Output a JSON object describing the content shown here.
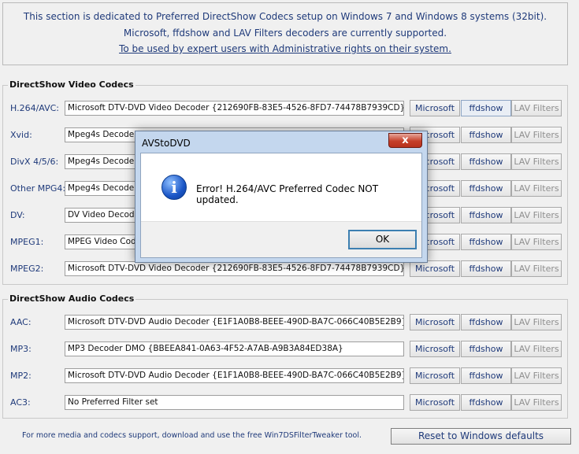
{
  "header": {
    "line1": "This section is dedicated to Preferred DirectShow Codecs setup on Windows 7 and Windows 8 systems (32bit).",
    "line2": "Microsoft, ffdshow and LAV Filters decoders are currently supported.",
    "link": "To be used by expert users with Administrative rights on their system."
  },
  "video": {
    "title": "DirectShow Video Codecs",
    "rows": [
      {
        "label": "H.264/AVC:",
        "value": "Microsoft DTV-DVD Video Decoder {212690FB-83E5-4526-8FD7-74478B7939CD}"
      },
      {
        "label": "Xvid:",
        "value": "Mpeg4s Decoder DMO {2A11BAE2-FE6E-4249-864B-9E9ED6E8DBC2}"
      },
      {
        "label": "DivX 4/5/6:",
        "value": "Mpeg4s Decoder DMO {2A11BAE2-FE6E-4249-864B-9E9ED6E8DBC2}"
      },
      {
        "label": "Other MPG4:",
        "value": "Mpeg4s Decoder DMO {2A11BAE2-FE6E-4249-864B-9E9ED6E8DBC2}"
      },
      {
        "label": "DV:",
        "value": "DV Video Decoder {B1B77C00-C3E4-11CF-AF79-00AA00B67A42}"
      },
      {
        "label": "MPEG1:",
        "value": "MPEG Video Codec {FEB50740-7BEF-11CE-9BD9-0000E202599C}"
      },
      {
        "label": "MPEG2:",
        "value": "Microsoft DTV-DVD Video Decoder {212690FB-83E5-4526-8FD7-74478B7939CD}"
      }
    ]
  },
  "audio": {
    "title": "DirectShow Audio Codecs",
    "rows": [
      {
        "label": "AAC:",
        "value": "Microsoft DTV-DVD Audio Decoder {E1F1A0B8-BEEE-490D-BA7C-066C40B5E2B9}"
      },
      {
        "label": "MP3:",
        "value": "MP3 Decoder DMO {BBEEA841-0A63-4F52-A7AB-A9B3A84ED38A}"
      },
      {
        "label": "MP2:",
        "value": "Microsoft DTV-DVD Audio Decoder {E1F1A0B8-BEEE-490D-BA7C-066C40B5E2B9}"
      },
      {
        "label": "AC3:",
        "value": "No Preferred Filter set"
      }
    ]
  },
  "buttons": {
    "microsoft": "Microsoft",
    "ffdshow": "ffdshow",
    "lav": "LAV Filters"
  },
  "footer": {
    "note": "For more media and codecs support, download and use the free Win7DSFilterTweaker tool.",
    "reset": "Reset to Windows defaults"
  },
  "dialog": {
    "title": "AVStoDVD",
    "close": "x",
    "message": "Error! H.264/AVC Preferred Codec NOT updated.",
    "ok": "OK",
    "icon": "i"
  }
}
